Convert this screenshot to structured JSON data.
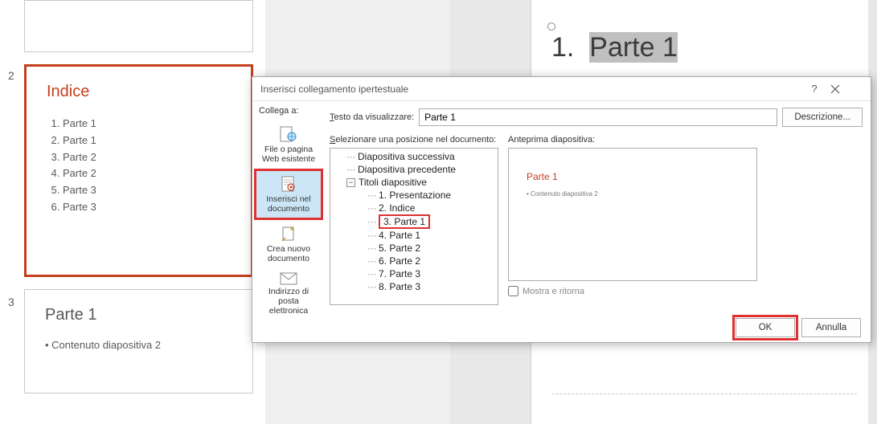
{
  "thumbs": {
    "num2": "2",
    "num3": "3",
    "indice_title": "Indice",
    "items": [
      "Parte 1",
      "Parte 1",
      "Parte 2",
      "Parte 2",
      "Parte 3",
      "Parte 3"
    ],
    "parte_title": "Parte 1",
    "parte_bullet": "• Contenuto diapositiva 2"
  },
  "main": {
    "num": "1.",
    "title": "Parte 1"
  },
  "dialog": {
    "title": "Inserisci collegamento ipertestuale",
    "side_label": "Collega a:",
    "side": {
      "file_web": "File o pagina Web esistente",
      "in_doc": "Inserisci nel documento",
      "new_doc": "Crea nuovo documento",
      "email": "Indirizzo di posta elettronica"
    },
    "text_label": "Testo da visualizzare:",
    "text_value": "Parte 1",
    "descr_btn": "Descrizione...",
    "pos_label": "Selezionare una posizione nel documento:",
    "preview_label": "Anteprima diapositiva:",
    "tree": {
      "next": "Diapositiva successiva",
      "prev": "Diapositiva precedente",
      "titles": "Titoli diapositive",
      "s1": "1. Presentazione",
      "s2": "2. Indice",
      "s3": "3. Parte 1",
      "s4": "4. Parte 1",
      "s5": "5. Parte 2",
      "s6": "6. Parte 2",
      "s7": "7. Parte 3",
      "s8": "8. Parte 3"
    },
    "preview": {
      "title": "Parte 1",
      "line": "• Contenuto diapositiva 2"
    },
    "show_return": "Mostra e ritorna",
    "ok": "OK",
    "cancel": "Annulla"
  }
}
